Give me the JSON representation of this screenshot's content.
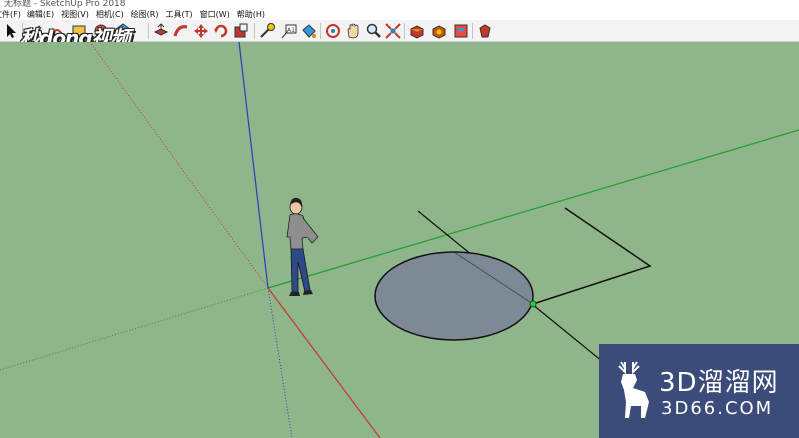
{
  "window": {
    "title": "无标题 - SketchUp Pro 2018"
  },
  "menu": {
    "items": [
      {
        "label": "文件(F)"
      },
      {
        "label": "编辑(E)"
      },
      {
        "label": "视图(V)"
      },
      {
        "label": "相机(C)"
      },
      {
        "label": "绘图(R)"
      },
      {
        "label": "工具(T)"
      },
      {
        "label": "窗口(W)"
      },
      {
        "label": "帮助(H)"
      }
    ]
  },
  "toolbar": {
    "tools": [
      "select-arrow-icon",
      "line-pencil-icon",
      "arc-icon",
      "rectangle-icon",
      "circle-icon",
      "polygon-icon",
      "push-pull-icon",
      "follow-me-icon",
      "move-icon",
      "rotate-icon",
      "scale-icon",
      "paint-bucket-icon",
      "tape-measure-icon",
      "text-icon",
      "dimension-icon",
      "orbit-icon",
      "pan-icon",
      "zoom-icon",
      "zoom-extents-icon",
      "3d-warehouse-icon",
      "extension-warehouse-icon",
      "layout-icon",
      "ruby-icon"
    ]
  },
  "overlays": {
    "video_watermark": "秒dong视频",
    "brand_cn": "3D溜溜网",
    "brand_en": "3D66.COM"
  },
  "colors": {
    "viewport_bg": "#8fb58a",
    "axis_red": "#c23a2b",
    "axis_green": "#1f9e2b",
    "axis_blue": "#2a3fb5",
    "circle_face": "#7d8a95",
    "brand_bg": "#3b4c7a"
  }
}
